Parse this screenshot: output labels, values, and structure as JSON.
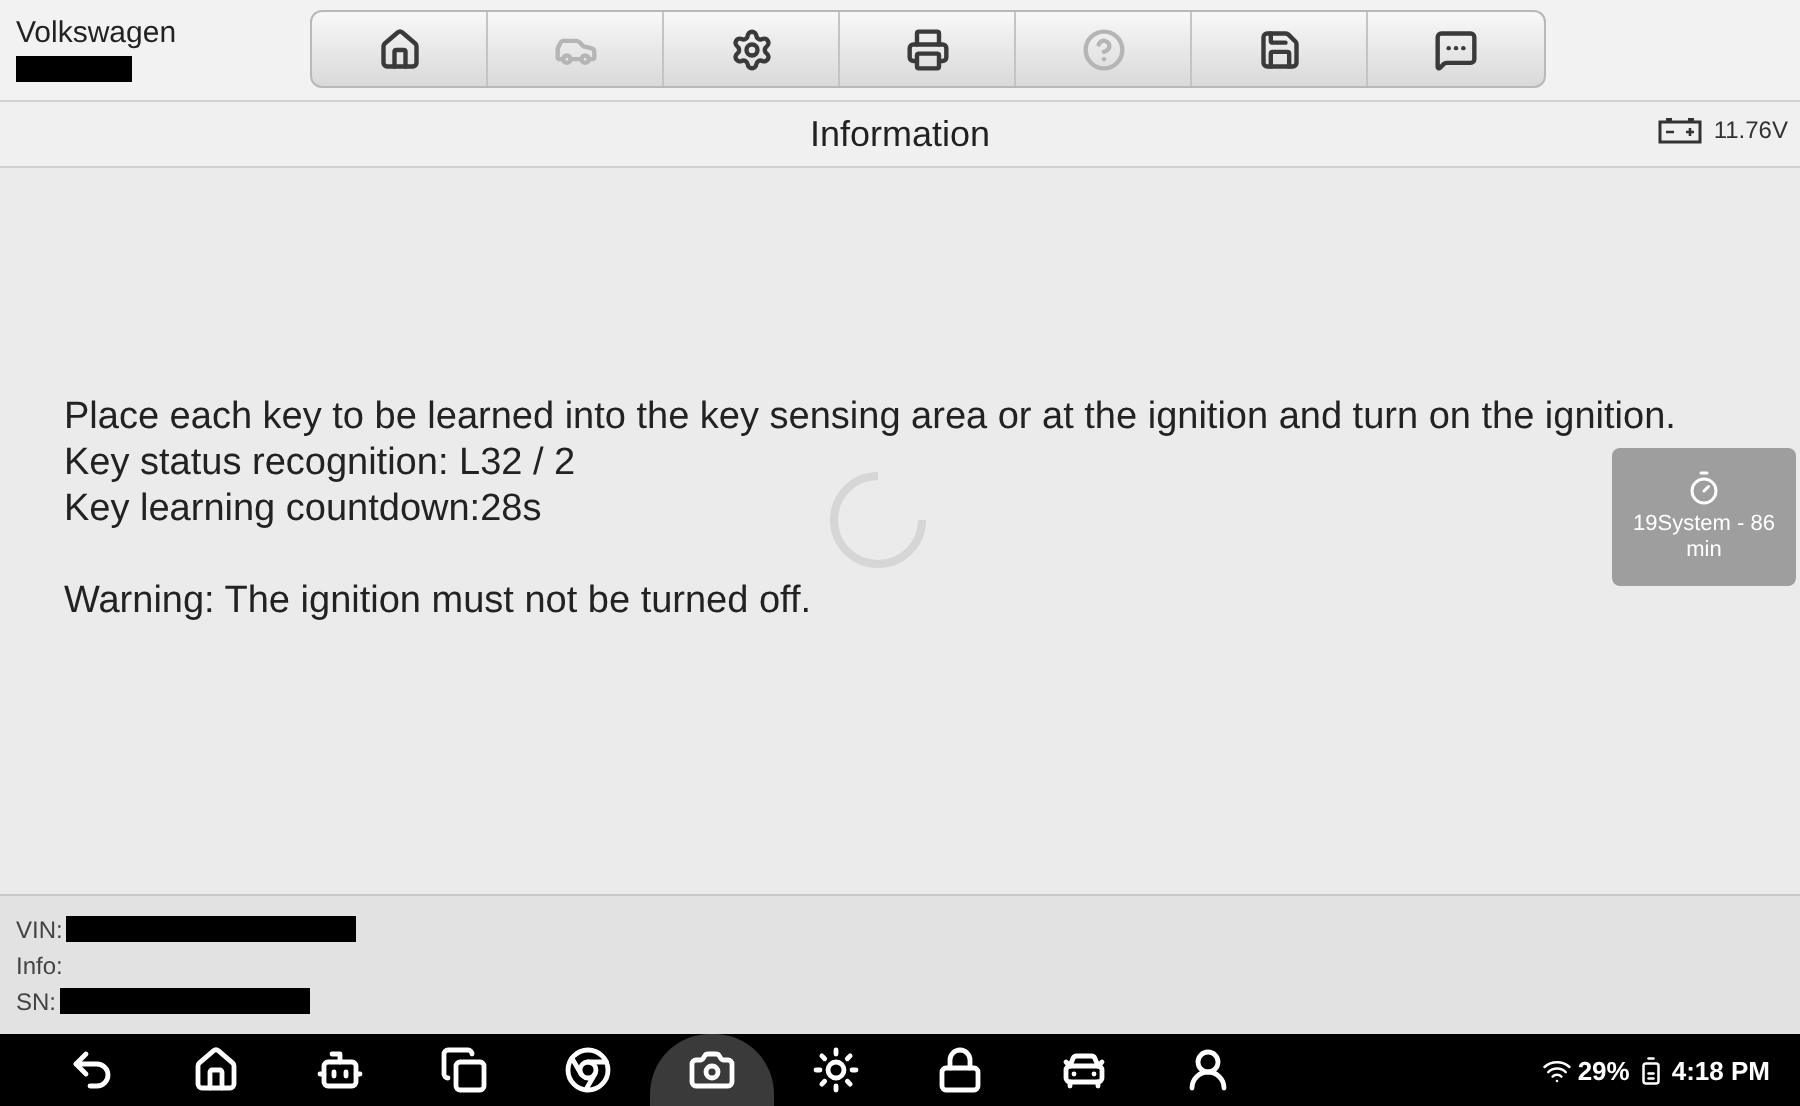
{
  "header": {
    "vehicle": "Volkswagen"
  },
  "toolbar": [
    {
      "kind": "home",
      "disabled": false
    },
    {
      "kind": "lift",
      "disabled": true
    },
    {
      "kind": "settings",
      "disabled": false
    },
    {
      "kind": "print",
      "disabled": false
    },
    {
      "kind": "help",
      "disabled": true
    },
    {
      "kind": "save",
      "disabled": false
    },
    {
      "kind": "message",
      "disabled": false
    }
  ],
  "title_bar": {
    "title": "Information",
    "voltage": "11.76V"
  },
  "content": {
    "paragraphs": [
      [
        "Place each key to be learned into the key sensing area or at the ignition and turn on the ignition.",
        "Key status recognition: L32 / 2",
        "Key learning countdown:28s"
      ],
      [
        "Warning: The ignition must not be turned off."
      ]
    ]
  },
  "timer": {
    "label": "19System - 86 min"
  },
  "footer": [
    {
      "label": "VIN:",
      "kind": "redacted"
    },
    {
      "label": "Info:",
      "kind": "blank"
    },
    {
      "label": "SN:",
      "kind": "redacted"
    }
  ],
  "nav_bar": [
    {
      "kind": "back",
      "selected": false
    },
    {
      "kind": "home",
      "selected": false
    },
    {
      "kind": "android",
      "selected": false
    },
    {
      "kind": "recents",
      "selected": false
    },
    {
      "kind": "browser",
      "selected": false
    },
    {
      "kind": "camera",
      "selected": true
    },
    {
      "kind": "brightness",
      "selected": false
    },
    {
      "kind": "immobilizer",
      "selected": false
    },
    {
      "kind": "car",
      "selected": false
    },
    {
      "kind": "service",
      "selected": false
    }
  ],
  "status": {
    "battery": "29%",
    "time": "4:18 PM"
  }
}
